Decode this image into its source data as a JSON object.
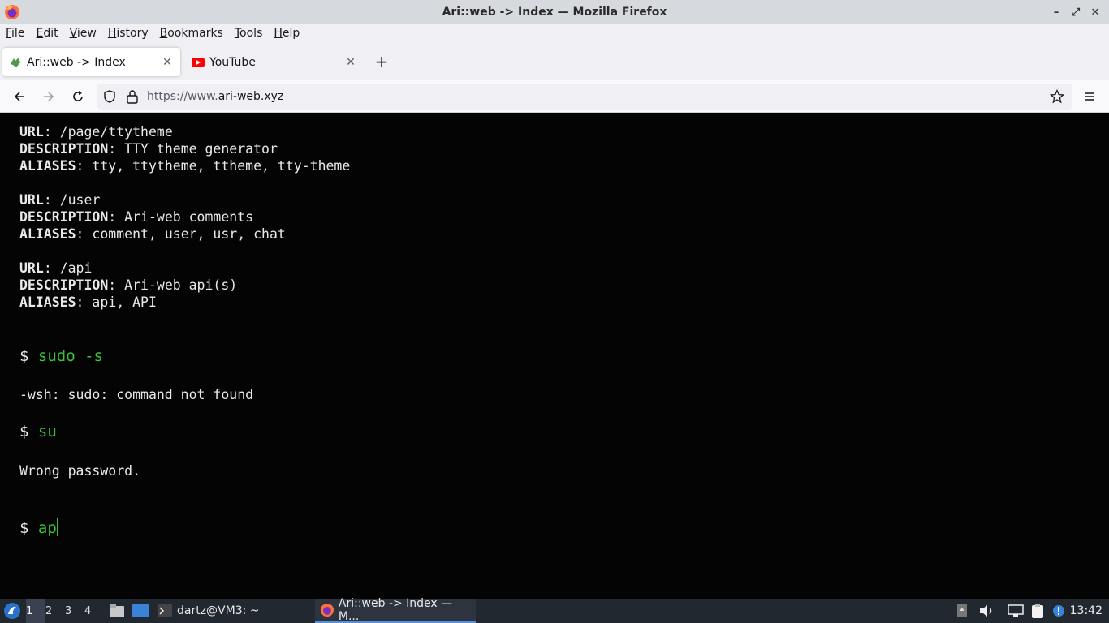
{
  "window": {
    "title": "Ari::web -> Index — Mozilla Firefox"
  },
  "menu": [
    "File",
    "Edit",
    "View",
    "History",
    "Bookmarks",
    "Tools",
    "Help"
  ],
  "tabs": [
    {
      "label": "Ari::web -> Index",
      "icon": "ari-web-favicon-icon",
      "active": true
    },
    {
      "label": "YouTube",
      "icon": "youtube-icon",
      "active": false
    }
  ],
  "urlbar": {
    "prefix": "https://www.",
    "domain": "ari-web.xyz"
  },
  "terminal": {
    "entries": [
      {
        "url": "/page/ttytheme",
        "description": "TTY theme generator",
        "aliases": "tty, ttytheme, ttheme, tty-theme"
      },
      {
        "url": "/user",
        "description": "Ari-web comments",
        "aliases": "comment, user, usr, chat"
      },
      {
        "url": "/api",
        "description": "Ari-web api(s)",
        "aliases": "api, API"
      }
    ],
    "labels": {
      "url": "URL",
      "description": "DESCRIPTION",
      "aliases": "ALIASES"
    },
    "prompt_symbol": "$",
    "cmd1": "sudo -s",
    "out1": "-wsh: sudo: command not found",
    "cmd2": "su",
    "out2": "Wrong password.",
    "cmd3": "ap"
  },
  "taskbar": {
    "workspaces": [
      "1",
      "2",
      "3",
      "4"
    ],
    "terminal_task": "dartz@VM3: ~",
    "firefox_task": "Ari::web -> Index — M...",
    "clock": "13:42"
  },
  "colors": {
    "prompt_green": "#3bc23b",
    "terminal_bg": "#040404",
    "taskbar_bg": "#222830"
  }
}
